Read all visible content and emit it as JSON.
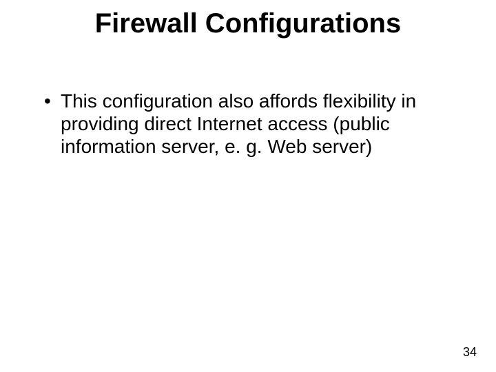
{
  "slide": {
    "title": "Firewall Configurations",
    "bullets": [
      "This configuration also affords flexibility in providing direct Internet access (public information server, e. g. Web server)"
    ],
    "page_number": "34"
  }
}
